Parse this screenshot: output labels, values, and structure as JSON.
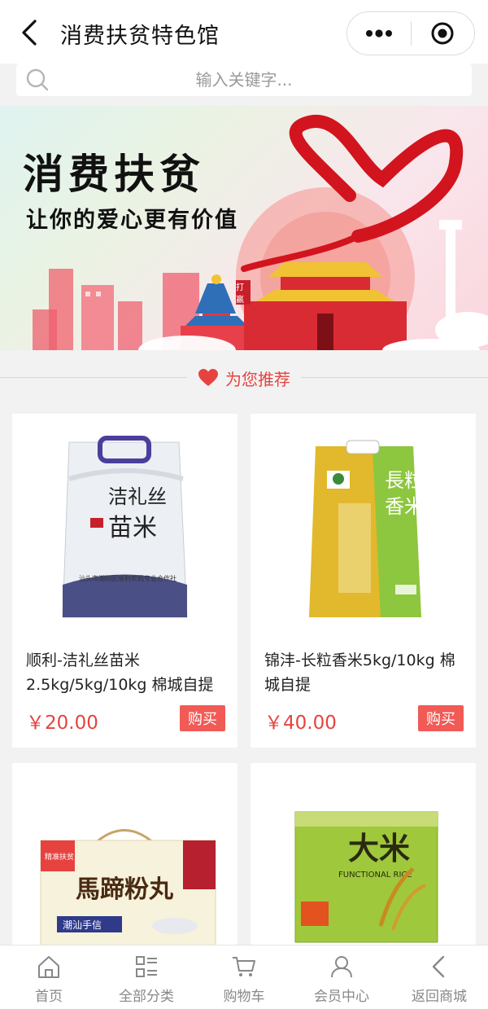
{
  "header": {
    "title": "消费扶贫特色馆",
    "back_icon": "chevron-left-icon",
    "more_icon": "more-dots-icon",
    "close_icon": "target-circle-icon"
  },
  "search": {
    "placeholder": "输入关键字...",
    "icon": "search-icon"
  },
  "banner": {
    "title": "消费扶贫",
    "subtitle": "让你的爱心更有价值",
    "stamp": "打赢"
  },
  "section": {
    "label": "为您推荐",
    "icon": "heart-icon",
    "accent": "#e64340"
  },
  "products": [
    {
      "name": "顺利-洁礼丝苗米2.5kg/5kg/10kg 棉城自提",
      "price": "￥20.00",
      "buy_label": "购买",
      "package_text": "洁礼丝苗米",
      "package_sub": "汕头市潮阳区顺利农机专业合作社"
    },
    {
      "name": "锦沣-长粒香米5kg/10kg 棉城自提",
      "price": "￥40.00",
      "buy_label": "购买",
      "package_text": "长粒香米",
      "package_sub": ""
    },
    {
      "name": "",
      "price": "",
      "buy_label": "",
      "package_text": "馬蹄粉丸",
      "package_sub": "潮汕手信",
      "package_badge": "精准扶贫"
    },
    {
      "name": "",
      "price": "",
      "buy_label": "",
      "package_text": "大米",
      "package_sub": "FUNCTIONAL RICE"
    }
  ],
  "tabbar": [
    {
      "label": "首页",
      "icon": "home-icon"
    },
    {
      "label": "全部分类",
      "icon": "category-list-icon"
    },
    {
      "label": "购物车",
      "icon": "cart-icon"
    },
    {
      "label": "会员中心",
      "icon": "user-icon"
    },
    {
      "label": "返回商城",
      "icon": "chevron-left-icon"
    }
  ],
  "colors": {
    "accent_red": "#e64340",
    "buy_button": "#f15a55",
    "background": "#f2f2f2"
  }
}
